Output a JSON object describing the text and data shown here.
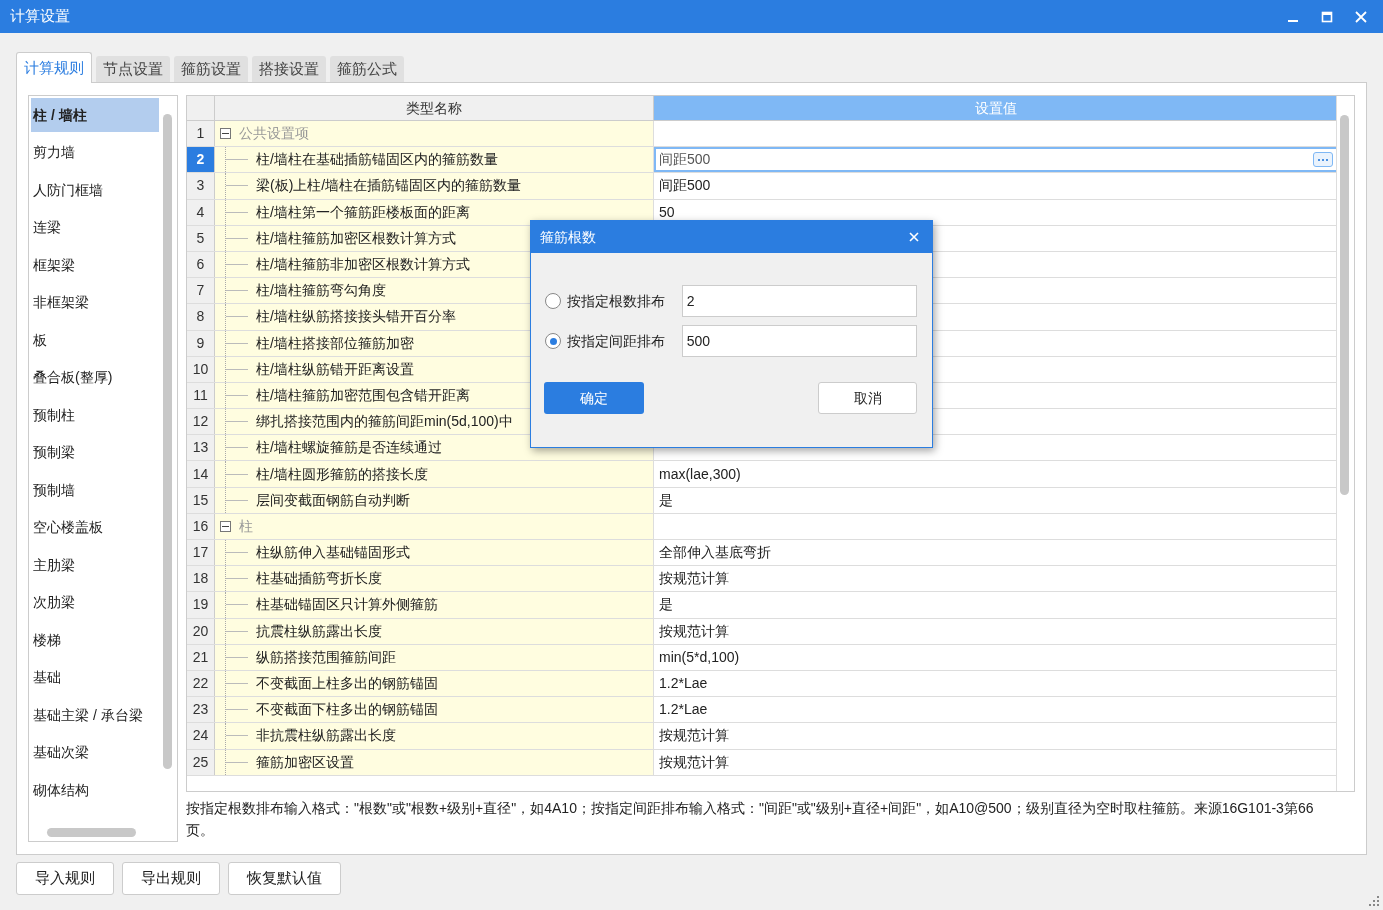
{
  "window": {
    "title": "计算设置"
  },
  "tabs": [
    {
      "label": "计算规则",
      "selected": true
    },
    {
      "label": "节点设置",
      "selected": false
    },
    {
      "label": "箍筋设置",
      "selected": false
    },
    {
      "label": "搭接设置",
      "selected": false
    },
    {
      "label": "箍筋公式",
      "selected": false
    }
  ],
  "sidebar": {
    "items": [
      {
        "label": "柱 / 墙柱",
        "selected": true
      },
      {
        "label": "剪力墙",
        "selected": false
      },
      {
        "label": "人防门框墙",
        "selected": false
      },
      {
        "label": "连梁",
        "selected": false
      },
      {
        "label": "框架梁",
        "selected": false
      },
      {
        "label": "非框架梁",
        "selected": false
      },
      {
        "label": "板",
        "selected": false
      },
      {
        "label": "叠合板(整厚)",
        "selected": false
      },
      {
        "label": "预制柱",
        "selected": false
      },
      {
        "label": "预制梁",
        "selected": false
      },
      {
        "label": "预制墙",
        "selected": false
      },
      {
        "label": "空心楼盖板",
        "selected": false
      },
      {
        "label": "主肋梁",
        "selected": false
      },
      {
        "label": "次肋梁",
        "selected": false
      },
      {
        "label": "楼梯",
        "selected": false
      },
      {
        "label": "基础",
        "selected": false
      },
      {
        "label": "基础主梁 / 承台梁",
        "selected": false
      },
      {
        "label": "基础次梁",
        "selected": false
      },
      {
        "label": "砌体结构",
        "selected": false
      }
    ]
  },
  "table": {
    "columns": [
      {
        "label": "类型名称",
        "selected": false
      },
      {
        "label": "设置值",
        "selected": true
      }
    ],
    "rows": [
      {
        "number": "1",
        "kind": "group",
        "expanded": true,
        "name": "公共设置项",
        "selected": false
      },
      {
        "number": "2",
        "kind": "item",
        "name": "柱/墙柱在基础插筋锚固区内的箍筋数量",
        "value": "间距500",
        "selected": true
      },
      {
        "number": "3",
        "kind": "item",
        "name": "梁(板)上柱/墙柱在插筋锚固区内的箍筋数量",
        "value": "间距500",
        "selected": false
      },
      {
        "number": "4",
        "kind": "item",
        "name": "柱/墙柱第一个箍筋距楼板面的距离",
        "value": "50",
        "selected": false
      },
      {
        "number": "5",
        "kind": "item",
        "name": "柱/墙柱箍筋加密区根数计算方式",
        "selected": false
      },
      {
        "number": "6",
        "kind": "item",
        "name": "柱/墙柱箍筋非加密区根数计算方式",
        "selected": false
      },
      {
        "number": "7",
        "kind": "item",
        "name": "柱/墙柱箍筋弯勾角度",
        "selected": false
      },
      {
        "number": "8",
        "kind": "item",
        "name": "柱/墙柱纵筋搭接接头错开百分率",
        "selected": false
      },
      {
        "number": "9",
        "kind": "item",
        "name": "柱/墙柱搭接部位箍筋加密",
        "selected": false
      },
      {
        "number": "10",
        "kind": "item",
        "name": "柱/墙柱纵筋错开距离设置",
        "selected": false
      },
      {
        "number": "11",
        "kind": "item",
        "name": "柱/墙柱箍筋加密范围包含错开距离",
        "selected": false
      },
      {
        "number": "12",
        "kind": "item",
        "name": "绑扎搭接范围内的箍筋间距min(5d,100)中",
        "selected": false
      },
      {
        "number": "13",
        "kind": "item",
        "name": "柱/墙柱螺旋箍筋是否连续通过",
        "selected": false
      },
      {
        "number": "14",
        "kind": "item",
        "name": "柱/墙柱圆形箍筋的搭接长度",
        "value": "max(lae,300)",
        "selected": false
      },
      {
        "number": "15",
        "kind": "item",
        "name": "层间变截面钢筋自动判断",
        "value": "是",
        "selected": false
      },
      {
        "number": "16",
        "kind": "group",
        "expanded": true,
        "name": "柱",
        "selected": false
      },
      {
        "number": "17",
        "kind": "item",
        "name": "柱纵筋伸入基础锚固形式",
        "value": "全部伸入基底弯折",
        "selected": false
      },
      {
        "number": "18",
        "kind": "item",
        "name": "柱基础插筋弯折长度",
        "value": "按规范计算",
        "selected": false
      },
      {
        "number": "19",
        "kind": "item",
        "name": "柱基础锚固区只计算外侧箍筋",
        "value": "是",
        "selected": false
      },
      {
        "number": "20",
        "kind": "item",
        "name": "抗震柱纵筋露出长度",
        "value": "按规范计算",
        "selected": false
      },
      {
        "number": "21",
        "kind": "item",
        "name": "纵筋搭接范围箍筋间距",
        "value": "min(5*d,100)",
        "selected": false
      },
      {
        "number": "22",
        "kind": "item",
        "name": "不变截面上柱多出的钢筋锚固",
        "value": "1.2*Lae",
        "selected": false
      },
      {
        "number": "23",
        "kind": "item",
        "name": "不变截面下柱多出的钢筋锚固",
        "value": "1.2*Lae",
        "selected": false
      },
      {
        "number": "24",
        "kind": "item",
        "name": "非抗震柱纵筋露出长度",
        "value": "按规范计算",
        "selected": false
      },
      {
        "number": "25",
        "kind": "item",
        "name": "箍筋加密区设置",
        "value": "按规范计算",
        "selected": false
      }
    ]
  },
  "note": "按指定根数排布输入格式：\"根数\"或\"根数+级别+直径\"，如4A10；按指定间距排布输入格式：\"间距\"或\"级别+直径+间距\"，如A10@500；级别直径为空时取柱箍筋。来源16G101-3第66页。",
  "buttons": [
    "导入规则",
    "导出规则",
    "恢复默认值"
  ],
  "dialog": {
    "title": "箍筋根数",
    "options": [
      {
        "label": "按指定根数排布",
        "value": "2",
        "selected": false
      },
      {
        "label": "按指定间距排布",
        "value": "500",
        "selected": true
      }
    ],
    "ok": "确定",
    "cancel": "取消"
  }
}
